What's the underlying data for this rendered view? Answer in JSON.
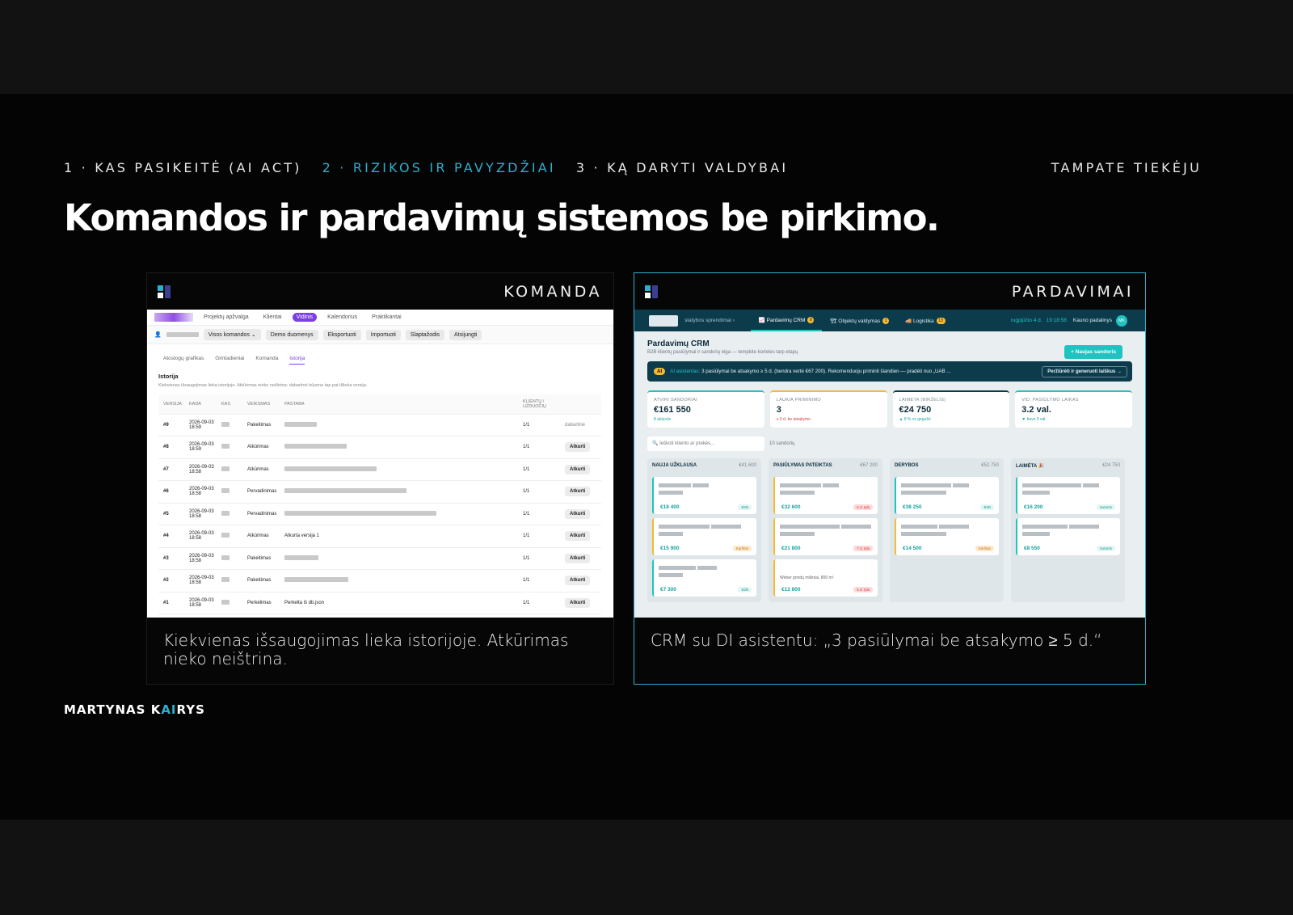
{
  "nav": {
    "sections": [
      {
        "label": "1 · KAS PASIKEITĖ (AI ACT)",
        "active": false
      },
      {
        "label": "2 · RIZIKOS IR PAVYZDŽIAI",
        "active": true
      },
      {
        "label": "3 · KĄ DARYTI VALDYBAI",
        "active": false
      }
    ],
    "right_label": "TAMPATE TIEKĖJU"
  },
  "title": "Komandos ir pardavimų sistemos be pirkimo.",
  "cards": {
    "left": {
      "label": "KOMANDA",
      "caption": "Kiekvienas išsaugojimas lieka istorijoje. Atkūrimas nieko neištrina.",
      "app": {
        "tabs": [
          {
            "label": "Projektų apžvalga",
            "active": false
          },
          {
            "label": "Klientai",
            "active": false
          },
          {
            "label": "Vidinis",
            "active": true
          },
          {
            "label": "Kalendorius",
            "active": false
          },
          {
            "label": "Praktikantai",
            "active": false
          }
        ],
        "toolbar": {
          "select": "Visos komandos",
          "buttons": [
            "Demo duomenys",
            "Eksportuoti",
            "Importuoti",
            "Slaptažodis",
            "Atsijungti"
          ]
        },
        "subtabs": [
          {
            "label": "Atostogų grafikas",
            "active": false
          },
          {
            "label": "Gimtadieniai",
            "active": false
          },
          {
            "label": "Komanda",
            "active": false
          },
          {
            "label": "Istorija",
            "active": true
          }
        ],
        "section_title": "Istorija",
        "section_desc": "Kiekvienas išsaugojimas lieka istorijoje. Atkūrimas nieko neištrina: dabartinė būsena tap pat išlieka versija.",
        "columns": [
          "VERSIJA",
          "KADA",
          "KAS",
          "VEIKSMAS",
          "PASTABA",
          "KLIENTŲ / UŽDUOČIŲ",
          ""
        ],
        "current_label": "dabartinė",
        "restore_label": "Atkurti",
        "rows": [
          {
            "ver": "#9",
            "when": "2026-09-03 18:59",
            "action": "Pakeitimas",
            "note": "",
            "count": "1/1",
            "current": true
          },
          {
            "ver": "#8",
            "when": "2026-09-03 18:59",
            "action": "Atkūrimas",
            "note": "",
            "count": "1/1",
            "current": false
          },
          {
            "ver": "#7",
            "when": "2026-09-03 18:58",
            "action": "Atkūrimas",
            "note": "",
            "count": "1/1",
            "current": false
          },
          {
            "ver": "#6",
            "when": "2026-09-03 18:58",
            "action": "Pervadinimas",
            "note": "",
            "count": "1/1",
            "current": false
          },
          {
            "ver": "#5",
            "when": "2026-09-03 18:58",
            "action": "Pervadinimas",
            "note": "",
            "count": "1/1",
            "current": false
          },
          {
            "ver": "#4",
            "when": "2026-09-03 18:58",
            "action": "Atkūrimas",
            "note": "Atkurta versija 1",
            "count": "1/1",
            "current": false
          },
          {
            "ver": "#3",
            "when": "2026-09-03 18:58",
            "action": "Pakeitimas",
            "note": "",
            "count": "1/1",
            "current": false
          },
          {
            "ver": "#2",
            "when": "2026-09-03 18:58",
            "action": "Pakeitimas",
            "note": "",
            "count": "1/1",
            "current": false
          },
          {
            "ver": "#1",
            "when": "2026-09-03 18:58",
            "action": "Perkėlimas",
            "note": "Perkelta iš db.json",
            "count": "1/1",
            "current": false
          }
        ]
      }
    },
    "right": {
      "label": "PARDAVIMAI",
      "caption": "CRM su DI asistentu: „3 pasiūlymai be atsakymo ≥ 5 d.“",
      "app": {
        "brand_sub": "statybos sprendimai ›",
        "tabs": [
          {
            "label": "📈 Pardavimų CRM",
            "badge": "8",
            "active": true
          },
          {
            "label": "🏗 Objektų valdymas",
            "badge": "1",
            "active": false
          },
          {
            "label": "🚚 Logistika",
            "badge": "13",
            "active": false
          }
        ],
        "date": "rugpjūčio 4 d.",
        "time": "19:18:58",
        "branch": "Kauno padalinys",
        "avatar": "MK",
        "page_title": "Pardavimų CRM",
        "page_sub": "B2B klientų pasiūlymai ir sandorių eiga — tempkite korteles tarp etapų",
        "new_button": "+ Naujas sandoris",
        "ai_badge": "AI",
        "ai_lead": "AI asistentas:",
        "ai_text": "3 pasiūlymai be atsakymo ≥ 5 d. (bendra vertė €67 200). Rekomenduoju priminti šiandien — pradėti nuo „UAB ...",
        "ai_button": "Peržiūrėti ir generuoti laiškus →",
        "kpis": [
          {
            "label": "ATVIRI SANDORIAI",
            "value": "€161 550",
            "sub": "8 aktyvūs",
            "color": "#1fc3c0"
          },
          {
            "label": "LAUKIA PRIMINIMO",
            "value": "3",
            "sub": "≥ 5 d. be atsakymo",
            "color": "#f5b933"
          },
          {
            "label": "LAIMĖTA (BIRŽELIS)",
            "value": "€24 750",
            "sub": "▲ 8 % vs gegužė",
            "color": "#0c3b4c"
          },
          {
            "label": "VID. PASIŪLYMO LAIKAS",
            "value": "3.2 val.",
            "sub": "▼ buvo 9 val.",
            "color": "#1fc3c0"
          }
        ],
        "search_placeholder": "🔍 Ieškoti kliento ar prekės...",
        "deal_count": "10 sandorių",
        "columns": [
          {
            "title": "NAUJA UŽKLAUSA",
            "sum": "€41 600",
            "deals": [
              {
                "amount": "€18 400",
                "tag": "B2B",
                "tone": "ok",
                "note": ""
              },
              {
                "amount": "€15 900",
                "tag": "Karštas",
                "tone": "warm",
                "note": ""
              },
              {
                "amount": "€7 300",
                "tag": "B2B",
                "tone": "ok",
                "note": ""
              }
            ]
          },
          {
            "title": "PASIŪLYMAS PATEIKTAS",
            "sum": "€67 200",
            "deals": [
              {
                "amount": "€32 600",
                "tag": "5 d. tyla",
                "tone": "red",
                "note": ""
              },
              {
                "amount": "€21 800",
                "tag": "7 d. tyla",
                "tone": "red",
                "note": ""
              },
              {
                "amount": "€12 800",
                "tag": "5 d. tyla",
                "tone": "red",
                "note": "Weber grindų mišiniai, 800 m²"
              }
            ]
          },
          {
            "title": "DERYBOS",
            "sum": "€52 750",
            "deals": [
              {
                "amount": "€38 250",
                "tag": "B2B",
                "tone": "ok",
                "note": ""
              },
              {
                "amount": "€14 500",
                "tag": "Karštas",
                "tone": "warm",
                "note": ""
              }
            ]
          },
          {
            "title": "LAIMĖTA 🎉",
            "sum": "€24 750",
            "deals": [
              {
                "amount": "€16 200",
                "tag": "Sutartis",
                "tone": "ok",
                "note": ""
              },
              {
                "amount": "€8 550",
                "tag": "Sutartis",
                "tone": "ok",
                "note": ""
              }
            ]
          }
        ]
      }
    }
  },
  "author": {
    "part1": "MARTYNAS K",
    "accent": "AI",
    "part2": "RYS"
  },
  "colors": {
    "accent": "#2ab0cf",
    "crm_dark": "#0c3b4c",
    "crm_teal": "#1fc3c0",
    "purple": "#7b3fe4"
  }
}
